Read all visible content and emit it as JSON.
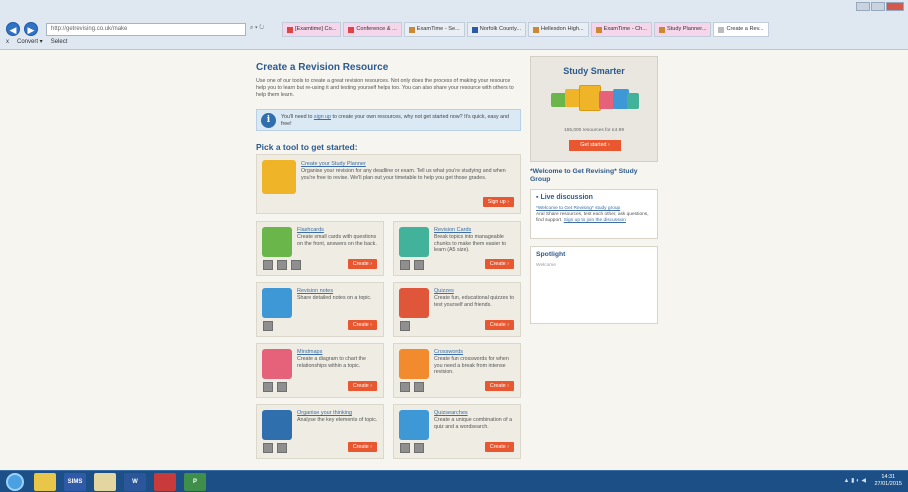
{
  "browser": {
    "url": "http://getrevising.co.uk/make",
    "search_icon": "search-icon",
    "tabs": [
      {
        "label": "[Examtime] Co...",
        "color": "#f5d6ea",
        "icon": "mail-icon"
      },
      {
        "label": "Conference & ...",
        "color": "#f5d6ea",
        "icon": "mail-icon"
      },
      {
        "label": "ExamTime - Se...",
        "color": "#e9eef5",
        "icon": "examtime-icon"
      },
      {
        "label": "Norfolk County...",
        "color": "#e9eef5",
        "icon": "grid-icon"
      },
      {
        "label": "Hellesdon High...",
        "color": "#e9eef5",
        "icon": "school-icon"
      },
      {
        "label": "ExamTime - Ch...",
        "color": "#f5d6ea",
        "icon": "examtime-icon"
      },
      {
        "label": "Study Planner...",
        "color": "#f5d6ea",
        "icon": "examtime-icon"
      },
      {
        "label": "Create a Rev...",
        "color": "#ffffff",
        "icon": "page-icon"
      }
    ],
    "command_bar": {
      "close": "x",
      "convert": "Convert",
      "select": "Select"
    }
  },
  "main": {
    "heading": "Create a Revision Resource",
    "intro": "Use one of our tools to create a great revision resources. Not only does the process of making your resource help you to learn but re-using it and testing yourself helps too. You can also share your resource with others to help them learn.",
    "info_pre": "You'll need to ",
    "info_link": "sign up",
    "info_post": " to create your own resources, why not get started now? It's quick, easy and free!",
    "pick_heading": "Pick a tool to get started:",
    "planner": {
      "title": "Create your Study Planner",
      "desc": "Organise your revision for any deadline or exam. Tell us what you're studying and when you're free to revise. We'll plan out your timetable to help you get those grades.",
      "button": "Sign up"
    },
    "tools": [
      {
        "title": "Flashcards",
        "desc": "Create small cards with questions on the front, answers on the back.",
        "button": "Create",
        "color": "#6bb64a"
      },
      {
        "title": "Revision Cards",
        "desc": "Break topics into manageable chunks to make them easier to learn (A5 size).",
        "button": "Create",
        "color": "#42b39a"
      },
      {
        "title": "Revision notes",
        "desc": "Share detailed notes on a topic.",
        "button": "Create",
        "color": "#3e98d6"
      },
      {
        "title": "Quizzes",
        "desc": "Create fun, educational quizzes to test yourself and friends.",
        "button": "Create",
        "color": "#e0563a"
      },
      {
        "title": "Mindmaps",
        "desc": "Create a diagram to chart the relationships within a topic.",
        "button": "Create",
        "color": "#e6627a"
      },
      {
        "title": "Crosswords",
        "desc": "Create fun crosswords for when you need a break from intense revision.",
        "button": "Create",
        "color": "#f28a2e"
      },
      {
        "title": "Organise your thinking",
        "desc": "Analyse the key elements of topic.",
        "button": "Create",
        "color": "#2f6fae"
      },
      {
        "title": "Quizsearches",
        "desc": "Create a unique combination of a quiz and a wordsearch.",
        "button": "Create",
        "color": "#3e98d6"
      }
    ]
  },
  "sidebar": {
    "study_smarter": "Study Smarter",
    "resources": "165,000 resources for £4.99",
    "get_started": "Get started",
    "welcome": "*Welcome to Get Revising* Study Group",
    "live_title": "Live discussion",
    "live_link": "*Welcome to Get Revising* study group",
    "live_desc_pre": "Aral Share resources, test each other, ask questions, find support. ",
    "live_desc_link": "Sign up to join the discussion",
    "spotlight": "Spotlight",
    "spotlight_sub": "Welcome"
  },
  "taskbar": {
    "apps": [
      {
        "label": "",
        "color": "#e8c64a",
        "icon": "ie-icon"
      },
      {
        "label": "SIMS",
        "color": "#2f5aa8",
        "icon": "sims-icon"
      },
      {
        "label": "",
        "color": "#e3d6a0",
        "icon": "folder-icon"
      },
      {
        "label": "W",
        "color": "#2b579a",
        "icon": "word-icon"
      },
      {
        "label": "",
        "color": "#c93b3b",
        "icon": "pdf-icon"
      },
      {
        "label": "P",
        "color": "#3f8f4a",
        "icon": "publisher-icon"
      }
    ],
    "time": "14:31",
    "date": "27/01/2015"
  }
}
